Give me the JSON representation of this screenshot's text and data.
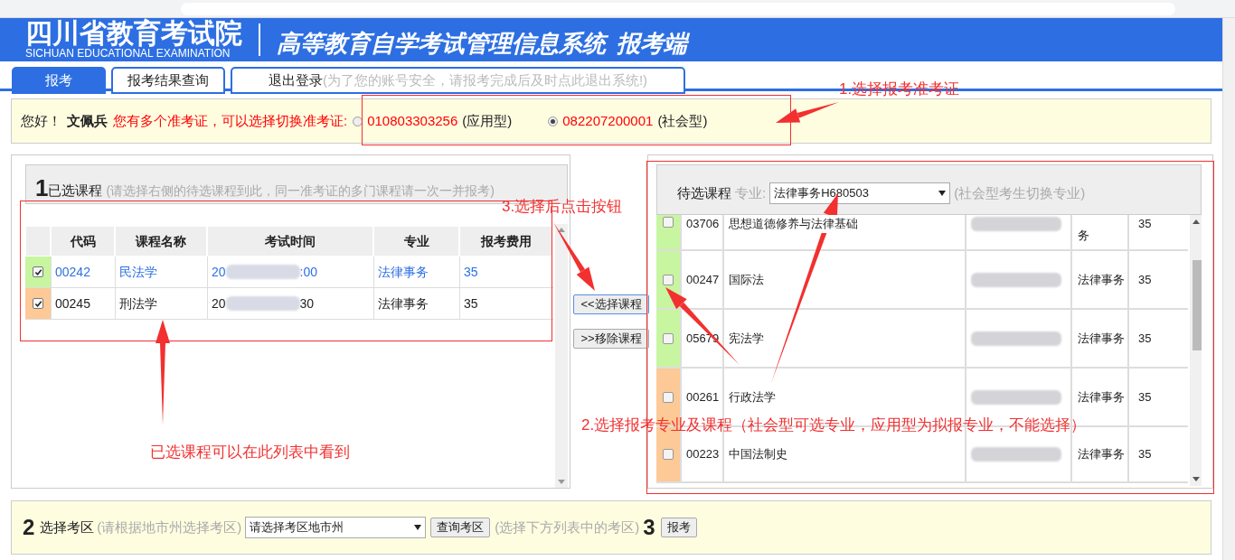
{
  "header": {
    "title": "四川省教育考试院",
    "subtitle": "SICHUAN EDUCATIONAL EXAMINATION",
    "system": "高等教育自学考试管理信息系统",
    "suffix": "报考端"
  },
  "tabs": [
    {
      "label": "报考",
      "selected": true
    },
    {
      "label": "报考结果查询",
      "selected": false
    },
    {
      "label": "退出登录",
      "hint": "(为了您的账号安全，请报考完成后及时点此退出系统!)",
      "selected": false
    }
  ],
  "greeting": {
    "hello": "您好！",
    "name": "文佩兵",
    "message": "您有多个准考证，可以选择切换准考证:",
    "tickets": [
      {
        "number": "010803303256",
        "type": "(应用型)",
        "selected": false
      },
      {
        "number": "082207200001",
        "type": "(社会型)",
        "selected": true
      }
    ]
  },
  "selected_panel": {
    "step": "1",
    "title": "已选课程",
    "hint": "(请选择右侧的待选课程到此，同一准考证的多门课程请一次一并报考)",
    "columns": [
      "代码",
      "课程名称",
      "考试时间",
      "专业",
      "报考费用"
    ],
    "rows": [
      {
        "color": "#c8f5a0",
        "checked": true,
        "linked": true,
        "code": "00242",
        "name": "民法学",
        "time_start": "20",
        "time_end": ":00",
        "major": "法律事务",
        "fee": "35"
      },
      {
        "color": "#fdc997",
        "checked": true,
        "linked": false,
        "code": "00245",
        "name": "刑法学",
        "time_start": "20",
        "time_end": "30",
        "major": "法律事务",
        "fee": "35"
      }
    ]
  },
  "buttons": [
    "<<选择课程",
    ">>移除课程"
  ],
  "available_panel": {
    "title": "待选课程",
    "major_label": "专业:",
    "major_value": "法律事务H680503",
    "hint": "(社会型考生切换专业)",
    "rows": [
      {
        "color": "#c8f5a0",
        "checked": false,
        "code": "03706",
        "name": "思想道德修养与法律基础",
        "major": "务",
        "fee": "35"
      },
      {
        "color": "#c8f5a0",
        "checked": false,
        "code": "00247",
        "name": "国际法",
        "major": "法律事务",
        "fee": "35"
      },
      {
        "color": "#c8f5a0",
        "checked": false,
        "code": "05679",
        "name": "宪法学",
        "major": "法律事务",
        "fee": "35"
      },
      {
        "color": "#fdc997",
        "checked": false,
        "code": "00261",
        "name": "行政法学",
        "major": "法律事务",
        "fee": "35"
      },
      {
        "color": "#fdc997",
        "checked": false,
        "code": "00223",
        "name": "中国法制史",
        "major": "法律事务",
        "fee": "35"
      }
    ]
  },
  "exam_area": {
    "step": "2",
    "title": "选择考区",
    "hint": "(请根据地市州选择考区)",
    "select": "请选择考区地市州",
    "button": "查询考区",
    "hint2": "(选择下方列表中的考区)",
    "step2": "3",
    "submit": "报考"
  },
  "annotations": [
    "1.选择报考准考证",
    "3.选择后点击按钮",
    "已选课程可以在此列表中看到",
    "2.选择报考专业及课程（社会型可选专业，应用型为拟报专业，不能选择）"
  ]
}
